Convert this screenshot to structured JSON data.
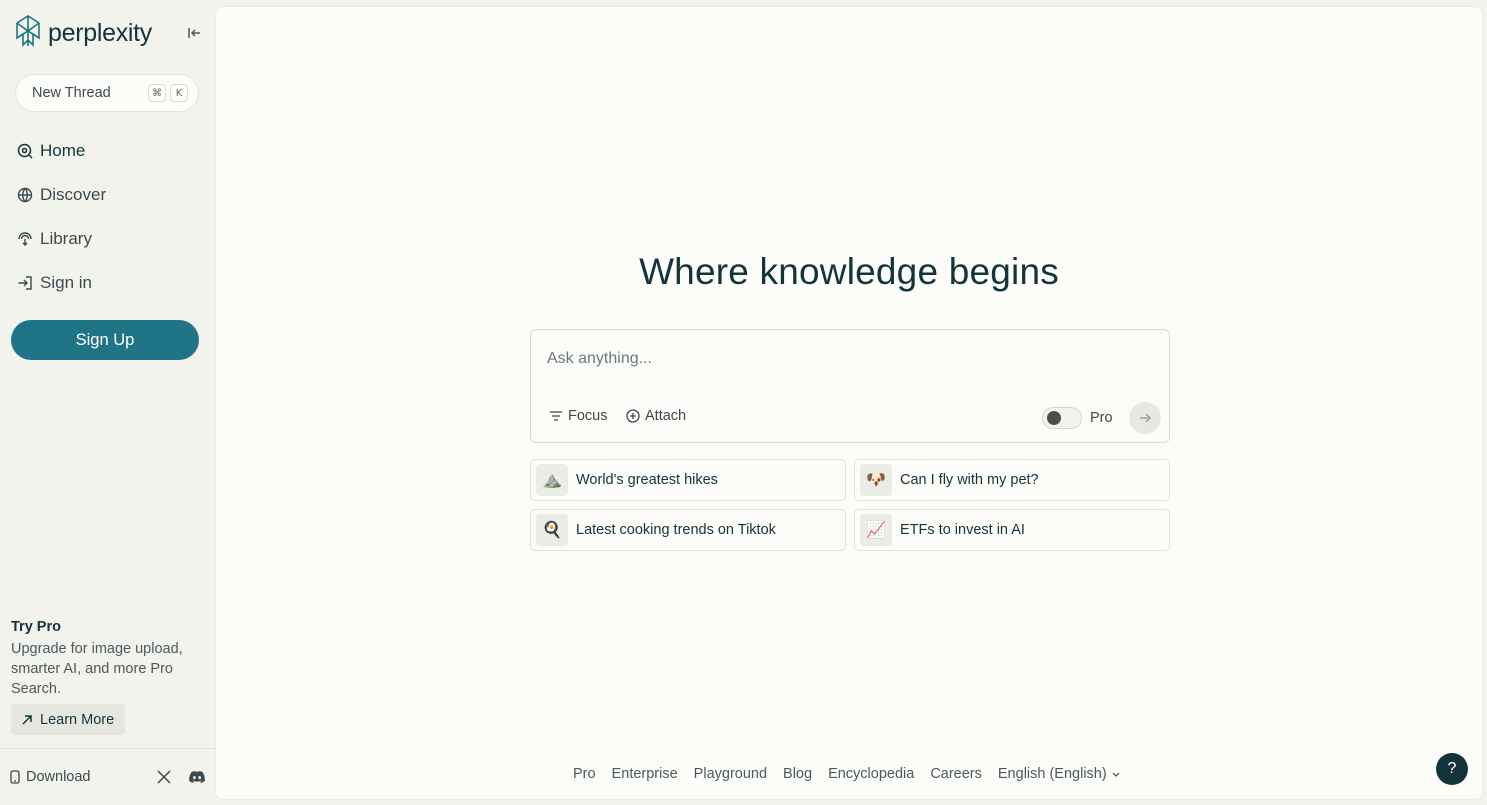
{
  "brand": {
    "name": "perplexity",
    "accent": "#1f7585",
    "ink": "#13343b"
  },
  "sidebar": {
    "new_thread": {
      "label": "New Thread",
      "shortcut": [
        "⌘",
        "K"
      ]
    },
    "nav": [
      {
        "label": "Home",
        "icon": "search-circle-icon",
        "active": true
      },
      {
        "label": "Discover",
        "icon": "globe-icon"
      },
      {
        "label": "Library",
        "icon": "library-icon"
      },
      {
        "label": "Sign in",
        "icon": "sign-in-icon"
      }
    ],
    "signup_label": "Sign Up",
    "try_pro": {
      "title": "Try Pro",
      "description": "Upgrade for image upload, smarter AI, and more Pro Search.",
      "button": "Learn More"
    },
    "footer": {
      "download_label": "Download"
    }
  },
  "main": {
    "headline": "Where knowledge begins",
    "search": {
      "placeholder": "Ask anything...",
      "focus_label": "Focus",
      "attach_label": "Attach",
      "pro_label": "Pro"
    },
    "suggestions": [
      {
        "emoji": "⛰️",
        "label": "World's greatest hikes"
      },
      {
        "emoji": "🐶",
        "label": "Can I fly with my pet?"
      },
      {
        "emoji": "🍳",
        "label": "Latest cooking trends on Tiktok"
      },
      {
        "emoji": "📈",
        "label": "ETFs to invest in AI"
      }
    ],
    "footer_links": [
      "Pro",
      "Enterprise",
      "Playground",
      "Blog",
      "Encyclopedia",
      "Careers"
    ],
    "language": "English (English)",
    "help_label": "?"
  }
}
